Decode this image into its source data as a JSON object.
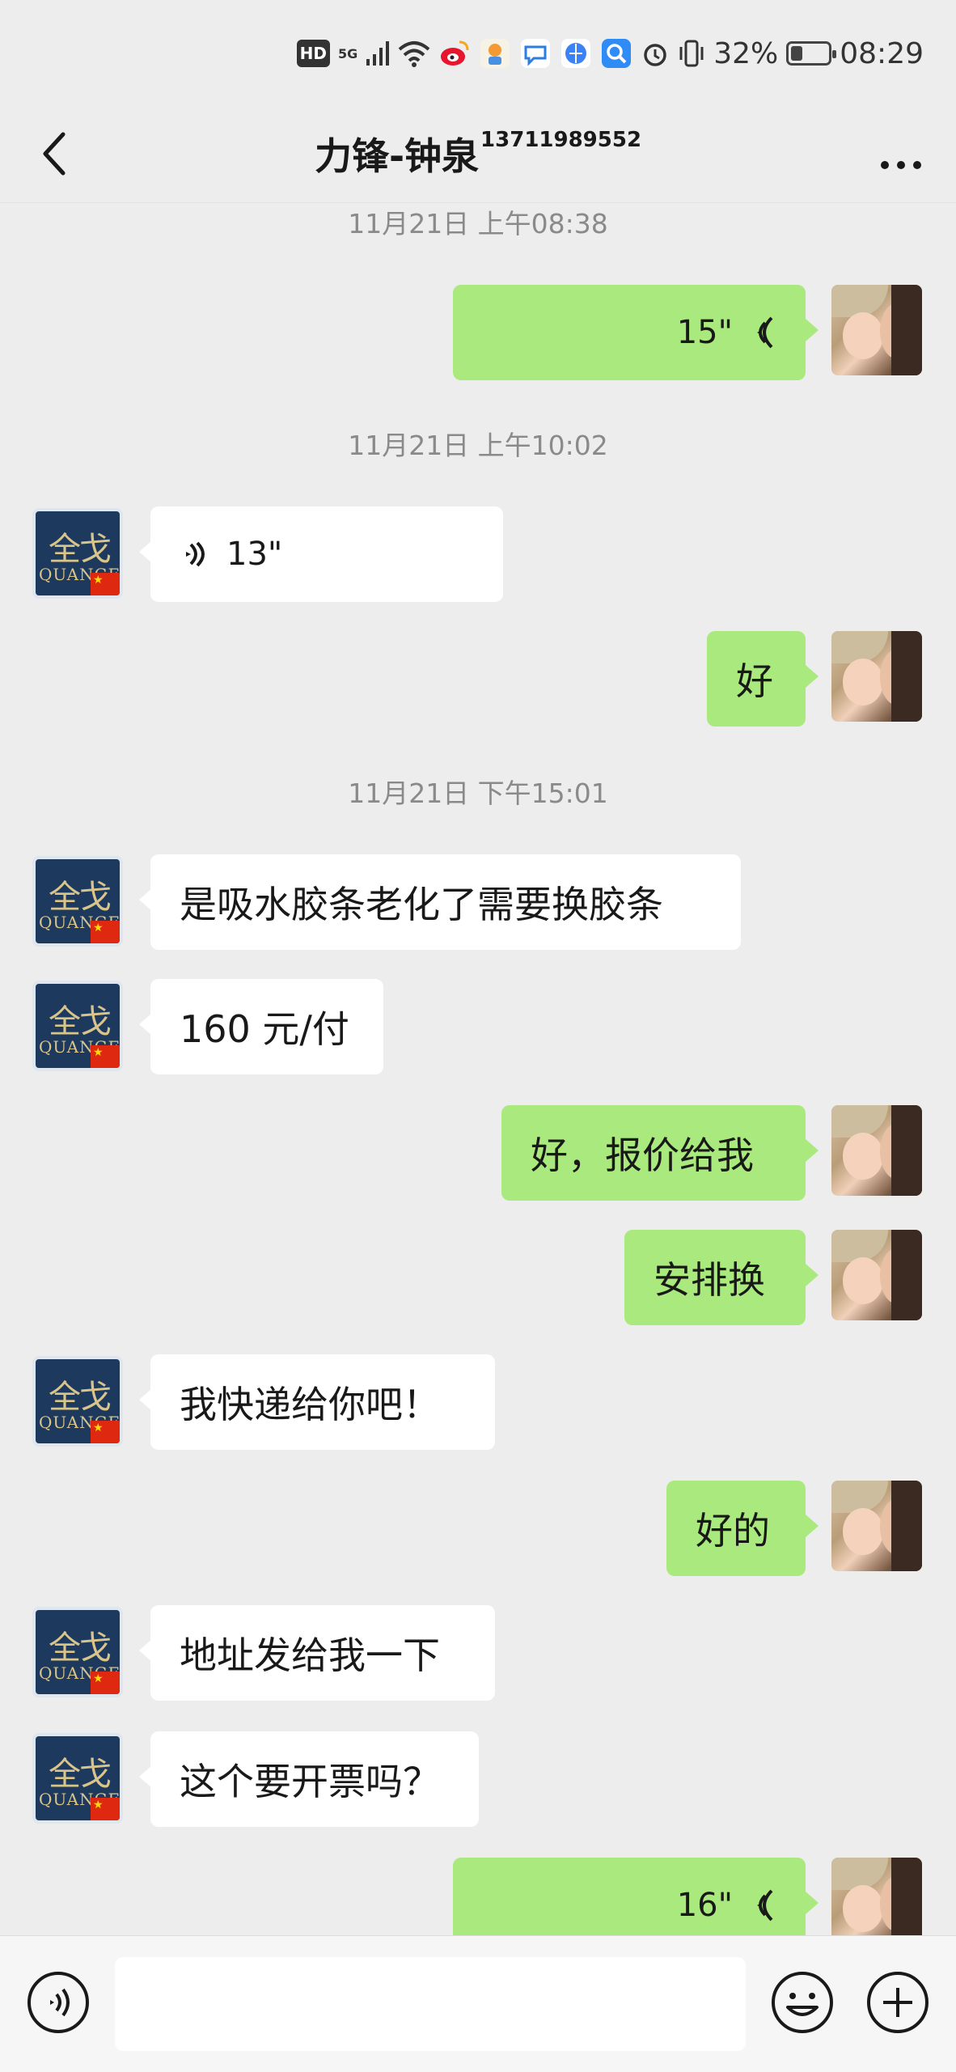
{
  "status_bar": {
    "hd": "HD",
    "network": "5G",
    "battery": "32%",
    "battery_level": 0.32,
    "time": "08:29",
    "icons": [
      "hd-icon",
      "signal-icon",
      "wifi-icon",
      "weibo-icon",
      "app-icon",
      "message-icon",
      "browser-icon",
      "search-app-icon",
      "alarm-icon",
      "vibrate-icon",
      "battery-icon"
    ]
  },
  "header": {
    "title": "力锋-钟泉",
    "phone": "13711989552"
  },
  "messages": {
    "t1": "11月21日 上午08:38",
    "m1": "15\"",
    "t2": "11月21日 上午10:02",
    "m2": "13\"",
    "m3": "好",
    "t3": "11月21日 下午15:01",
    "m4": "是吸水胶条老化了需要换胶条",
    "m5": "160 元/付",
    "m6": "好，报价给我",
    "m7": "安排换",
    "m8": "我快递给你吧！",
    "m9": "好的",
    "m10": "地址发给我一下",
    "m11": "这个要开票吗？",
    "m12": "16\""
  },
  "contact_avatar": {
    "logo_text": "全戈",
    "logo_word": "QUANGE"
  },
  "input": {
    "value": "",
    "placeholder": ""
  },
  "colors": {
    "background": "#ededed",
    "sent_bubble": "#a9e97d",
    "received_bubble": "#ffffff",
    "timestamp": "#8a8a8a"
  }
}
